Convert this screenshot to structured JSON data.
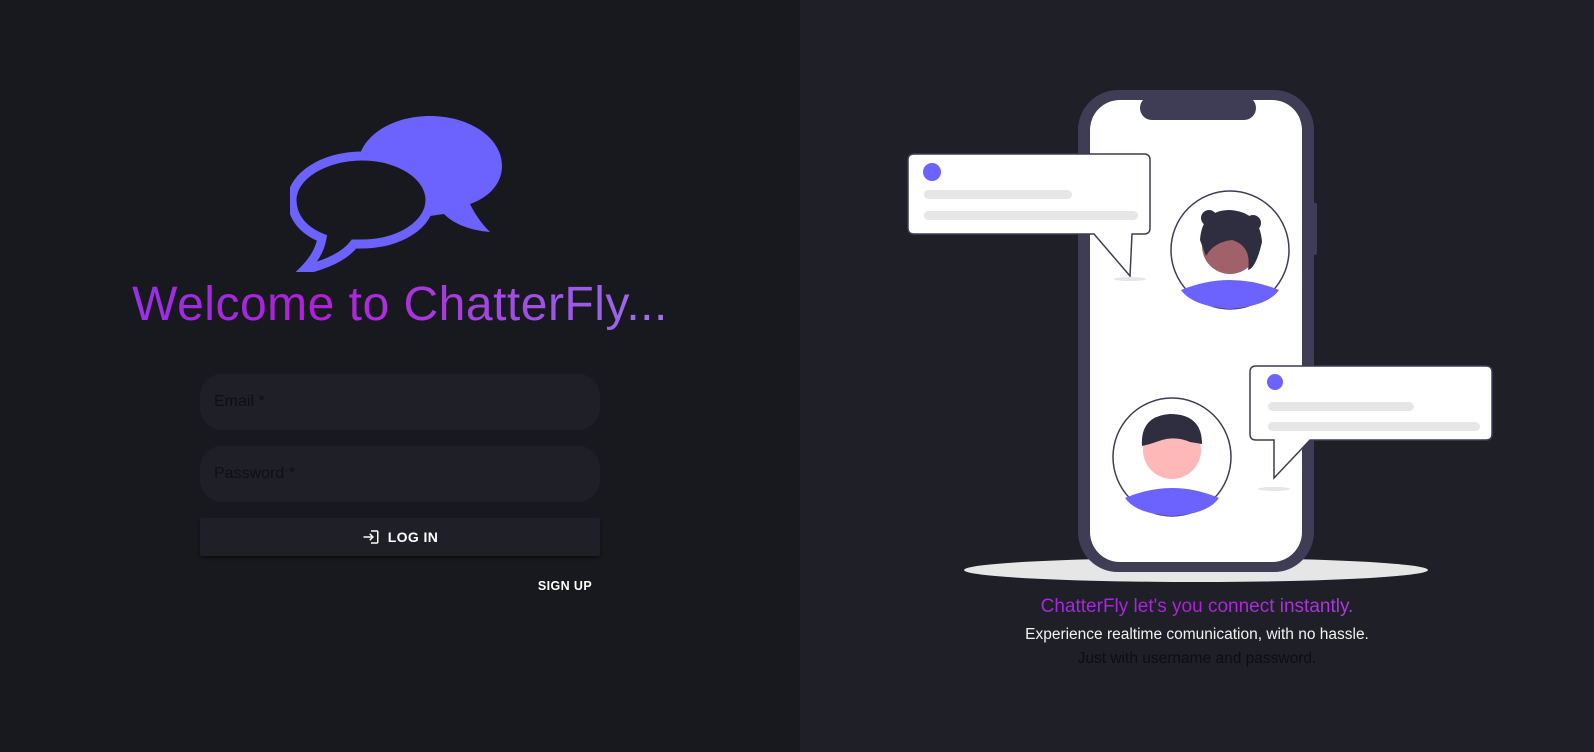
{
  "login": {
    "welcome_title": "Welcome to ChatterFly...",
    "email_label": "Email *",
    "password_label": "Password *",
    "login_label": "LOG IN",
    "signup_label": "SIGN UP"
  },
  "promo": {
    "tagline": "ChatterFly let's you connect instantly.",
    "description": "Experience realtime comunication, with no hassle.",
    "description_secondary": "Just with username and password."
  },
  "icons": {
    "logo": "chat-bubbles-icon",
    "login": "login-icon"
  },
  "colors": {
    "accent": "#6c63ff",
    "left_background": "#18191e",
    "right_background": "#1e1f27",
    "phone_frame": "#3f3d56"
  }
}
